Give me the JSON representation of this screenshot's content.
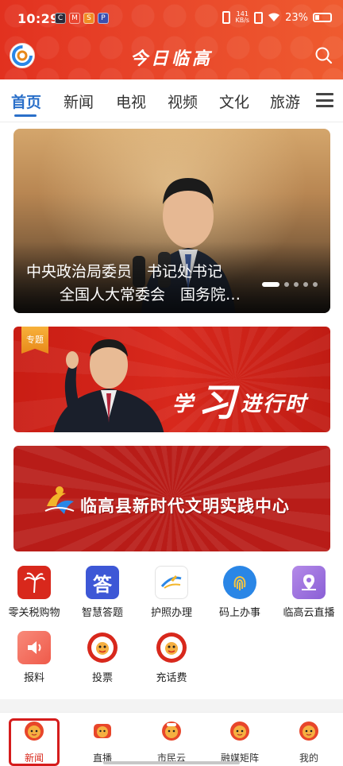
{
  "status_bar": {
    "time": "10:29",
    "net_speed_value": "141",
    "net_speed_unit": "KB/s",
    "battery": "23%",
    "app_icons": [
      "C",
      "M",
      "S",
      "P"
    ]
  },
  "header": {
    "title": "今日临高",
    "logo_letter": "G",
    "search_icon": "search-icon"
  },
  "tabs": [
    {
      "label": "首页",
      "active": true
    },
    {
      "label": "新闻",
      "active": false
    },
    {
      "label": "电视",
      "active": false
    },
    {
      "label": "视频",
      "active": false
    },
    {
      "label": "文化",
      "active": false
    },
    {
      "label": "旅游",
      "active": false
    }
  ],
  "hero": {
    "caption_line1": "中央政治局委员　书记处书记",
    "caption_line2": "全国人大常委会　国务院…",
    "slide_count": 5,
    "active_slide": 1
  },
  "banner_study": {
    "tag": "专题",
    "title_pre": "学",
    "title_big": "习",
    "title_post": "进行时"
  },
  "banner_civilization": {
    "title": "临高县新时代文明实践中心"
  },
  "services": [
    {
      "label": "零关税购物",
      "icon": "palm-tree-icon",
      "color": "#d8281c"
    },
    {
      "label": "智慧答题",
      "icon": "answer-icon",
      "color": "#3d57d6",
      "glyph": "答"
    },
    {
      "label": "护照办理",
      "icon": "airplane-icon",
      "color": "#ffffff"
    },
    {
      "label": "码上办事",
      "icon": "fingerprint-icon",
      "color": "#2a86e6"
    },
    {
      "label": "临高云直播",
      "icon": "location-pin-icon",
      "color": "#a077e0"
    },
    {
      "label": "报料",
      "icon": "speaker-icon",
      "color": "#f26b5b"
    },
    {
      "label": "投票",
      "icon": "vote-badge-icon",
      "color": "#d8281c"
    },
    {
      "label": "充话费",
      "icon": "recharge-badge-icon",
      "color": "#d8281c"
    }
  ],
  "bottom_nav": [
    {
      "label": "新闻",
      "icon": "news-mascot-icon",
      "active": true
    },
    {
      "label": "直播",
      "icon": "live-mascot-icon",
      "active": false
    },
    {
      "label": "市民云",
      "icon": "citizen-cloud-mascot-icon",
      "active": false
    },
    {
      "label": "融媒矩阵",
      "icon": "media-matrix-mascot-icon",
      "active": false
    },
    {
      "label": "我的",
      "icon": "profile-mascot-icon",
      "active": false
    }
  ],
  "colors": {
    "header_red": "#e2311f",
    "accent_blue": "#2a6fc9",
    "nav_active": "#d8281c",
    "highlight_box": "#d51c1c"
  }
}
